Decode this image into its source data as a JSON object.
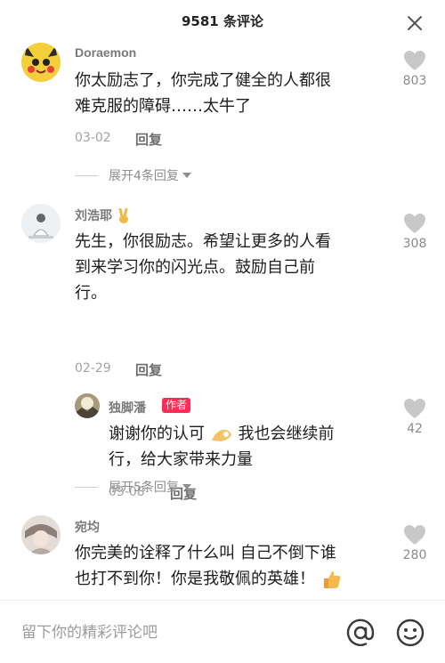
{
  "header": {
    "title": "9581 条评论",
    "close_icon": "close-icon"
  },
  "comments": [
    {
      "username": "Doraemon",
      "text_lines": [
        "你太励志了，你完成了健全的人都很",
        "难克服的障碍……太牛了"
      ],
      "date": "03-02",
      "reply_label": "回复",
      "likes": "803",
      "expand_label": "展开4条回复"
    },
    {
      "username": "刘浩耶",
      "username_emoji": "victory-hand-emoji",
      "text_lines": [
        "先生，你很励志。希望让更多的人看",
        "到来学习你的闪光点。鼓励自己前",
        "行。"
      ],
      "date": "02-29",
      "reply_label": "回复",
      "likes": "308",
      "reply": {
        "username": "独脚潘",
        "badge": "作者",
        "text_lines": [
          "谢谢你的认可",
          "我也会继续前",
          "行，给大家带来力量"
        ],
        "text_emoji": "ok-hand-emoji",
        "date": "03-08",
        "reply_label": "回复",
        "likes": "42"
      },
      "expand_label": "展开5条回复"
    },
    {
      "username": "宛均",
      "text_lines": [
        "你完美的诠释了什么叫 自己不倒下谁",
        "也打不到你！你是我敬佩的英雄！"
      ],
      "text_emoji": "thumbs-up-emoji",
      "likes": "280"
    }
  ],
  "footer": {
    "placeholder": "留下你的精彩评论吧",
    "at_icon": "at-icon",
    "emoji_icon": "smile-icon"
  },
  "colors": {
    "accent": "#fe2c55",
    "like_icon": "#c8c8c8",
    "text": "#1d1d1d",
    "meta": "#a3a3a3"
  }
}
